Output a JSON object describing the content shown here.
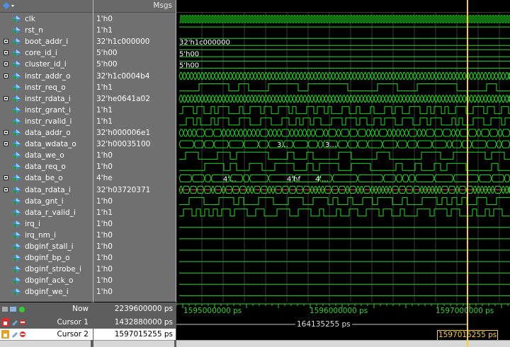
{
  "header": {
    "msgs_label": "Msgs"
  },
  "colors": {
    "wave": "#22dd22",
    "cursor": "#ffd21a",
    "red": "#d83030"
  },
  "signals": [
    {
      "name": "clk",
      "value": "1'h0",
      "expand": false
    },
    {
      "name": "rst_n",
      "value": "1'h1",
      "expand": false
    },
    {
      "name": "boot_addr_i",
      "value": "32'h1c000000",
      "expand": true
    },
    {
      "name": "core_id_i",
      "value": "5'h00",
      "expand": true
    },
    {
      "name": "cluster_id_i",
      "value": "5'h00",
      "expand": true
    },
    {
      "name": "instr_addr_o",
      "value": "32'h1c0004b4",
      "expand": true
    },
    {
      "name": "instr_req_o",
      "value": "1'h1",
      "expand": false
    },
    {
      "name": "instr_rdata_i",
      "value": "32'he0641a02",
      "expand": true
    },
    {
      "name": "instr_grant_i",
      "value": "1'h1",
      "expand": false
    },
    {
      "name": "instr_rvalid_i",
      "value": "1'h1",
      "expand": false
    },
    {
      "name": "data_addr_o",
      "value": "32'h000006e1",
      "expand": true
    },
    {
      "name": "data_wdata_o",
      "value": "32'h00035100",
      "expand": true
    },
    {
      "name": "data_we_o",
      "value": "1'h0",
      "expand": false
    },
    {
      "name": "data_req_o",
      "value": "1'h0",
      "expand": false
    },
    {
      "name": "data_be_o",
      "value": "4'he",
      "expand": true
    },
    {
      "name": "data_rdata_i",
      "value": "32'h03720371",
      "expand": true
    },
    {
      "name": "data_gnt_i",
      "value": "1'h0",
      "expand": false
    },
    {
      "name": "data_r_valid_i",
      "value": "1'h1",
      "expand": false
    },
    {
      "name": "irq_i",
      "value": "1'h0",
      "expand": false
    },
    {
      "name": "irq_nm_i",
      "value": "1'h0",
      "expand": false
    },
    {
      "name": "dbginf_stall_i",
      "value": "1'h0",
      "expand": false
    },
    {
      "name": "dbginf_bp_o",
      "value": "1'h0",
      "expand": false
    },
    {
      "name": "dbginf_strobe_i",
      "value": "1'h0",
      "expand": false
    },
    {
      "name": "dbginf_ack_o",
      "value": "1'h0",
      "expand": false
    },
    {
      "name": "dbginf_we_i",
      "value": "1'h0",
      "expand": false
    }
  ],
  "wave_labels": {
    "boot_addr": "32'h1c000000",
    "core_id": "5'h00",
    "cluster_id": "5'h00",
    "wdata_a": "3...",
    "wdata_b": "3...",
    "be_a": "4'...",
    "be_b": "4'hf",
    "be_c": "4'..."
  },
  "footer": {
    "now_label": "Now",
    "now_value": "2239600000 ps",
    "cursor1_label": "Cursor 1",
    "cursor1_value": "1432880000 ps",
    "cursor2_label": "Cursor 2",
    "cursor2_value": "1597015255 ps"
  },
  "timeline": {
    "ticks": [
      "1595000000 ps",
      "1596000000 ps",
      "1597000000 ps"
    ],
    "delta": "164135255 ps",
    "cursor_readout": "1597015255 ps"
  }
}
